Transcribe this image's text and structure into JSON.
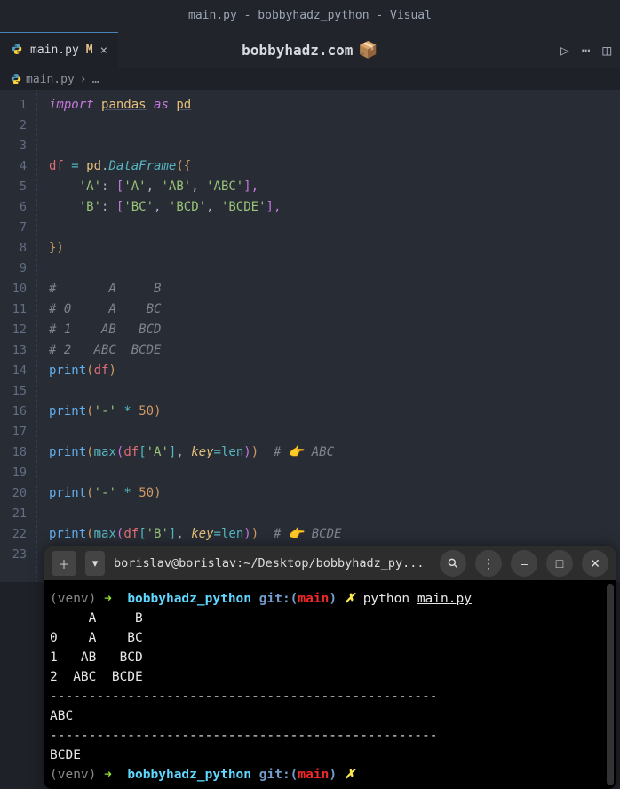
{
  "window": {
    "title": "main.py - bobbyhadz_python - Visual"
  },
  "tab": {
    "filename": "main.py",
    "modified": "M",
    "close": "×"
  },
  "header": {
    "site": "bobbyhadz.com",
    "cube": "📦"
  },
  "breadcrumb": {
    "file": "main.py",
    "sep": "›",
    "ellipsis": "…"
  },
  "gutter": {
    "lines": [
      "1",
      "2",
      "3",
      "4",
      "5",
      "6",
      "7",
      "8",
      "9",
      "10",
      "11",
      "12",
      "13",
      "14",
      "15",
      "16",
      "17",
      "18",
      "19",
      "20",
      "21",
      "22",
      "23"
    ]
  },
  "code": {
    "l1": {
      "import": "import",
      "module": "pandas",
      "as": "as",
      "alias": "pd"
    },
    "l4": {
      "var": "df",
      "eq": "=",
      "pd": "pd",
      "dot": ".",
      "fn": "DataFrame",
      "open": "({"
    },
    "l5": {
      "key": "'A'",
      "colon": ":",
      "open": "[",
      "v1": "'A'",
      "v2": "'AB'",
      "v3": "'ABC'",
      "close": "],",
      "comma": ","
    },
    "l6": {
      "key": "'B'",
      "colon": ":",
      "open": "[",
      "v1": "'BC'",
      "v2": "'BCD'",
      "v3": "'BCDE'",
      "close": "],",
      "comma": ","
    },
    "l8": {
      "close": "})"
    },
    "l10": {
      "c": "#       A     B"
    },
    "l11": {
      "c": "# 0     A    BC"
    },
    "l12": {
      "c": "# 1    AB   BCD"
    },
    "l13": {
      "c": "# 2   ABC  BCDE"
    },
    "l14": {
      "fn": "print",
      "open": "(",
      "arg": "df",
      "close": ")"
    },
    "l16": {
      "fn": "print",
      "open": "(",
      "str": "'-'",
      "mul": "*",
      "num": "50",
      "close": ")"
    },
    "l18": {
      "fn": "print",
      "open": "(",
      "max": "max",
      "open2": "(",
      "df": "df",
      "open3": "[",
      "key": "'A'",
      "close3": "]",
      "comma": ",",
      "keyparam": "key",
      "eq": "=",
      "len": "len",
      "close2": ")",
      "close": ")",
      "comment": "# 👉️ ABC"
    },
    "l20": {
      "fn": "print",
      "open": "(",
      "str": "'-'",
      "mul": "*",
      "num": "50",
      "close": ")"
    },
    "l22": {
      "fn": "print",
      "open": "(",
      "max": "max",
      "open2": "(",
      "df": "df",
      "open3": "[",
      "key": "'B'",
      "close3": "]",
      "comma": ",",
      "keyparam": "key",
      "eq": "=",
      "len": "len",
      "close2": ")",
      "close": ")",
      "comment": "# 👉️ BCDE"
    }
  },
  "terminal": {
    "title": "borislav@borislav:~/Desktop/bobbyhadz_py...",
    "venv": "(venv)",
    "arrow": "➜",
    "dir": "bobbyhadz_python",
    "git": "git:(",
    "branch": "main",
    "gitclose": ")",
    "dirty": "✗",
    "cmd": "python",
    "file": "main.py",
    "out1": "     A     B",
    "out2": "0    A    BC",
    "out3": "1   AB   BCD",
    "out4": "2  ABC  BCDE",
    "sep": "--------------------------------------------------",
    "out5": "ABC",
    "out6": "BCDE"
  }
}
